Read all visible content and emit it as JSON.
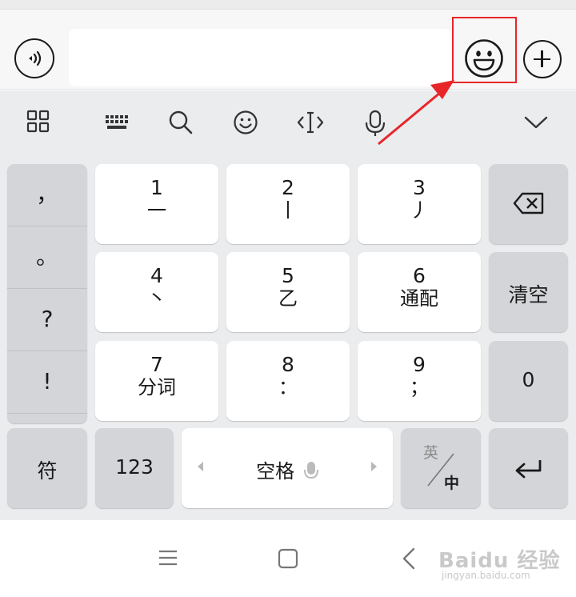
{
  "chat_bar": {
    "voice_icon": "voice-input-icon",
    "input_value": "",
    "emoji_icon": "smiley-emoji-icon",
    "plus_icon": "plus-circle-icon"
  },
  "annotation": {
    "color": "#e8262a"
  },
  "toolbar": {
    "items": [
      "grid-menu-icon",
      "keyboard-icon",
      "search-icon",
      "emoji-icon",
      "cursor-icon",
      "microphone-icon",
      "chevron-down-icon"
    ]
  },
  "keyboard": {
    "punctuation": [
      "，",
      "。",
      "?",
      "!"
    ],
    "keys": {
      "k1": {
        "num": "1",
        "sub": "一"
      },
      "k2": {
        "num": "2",
        "sub": "丨"
      },
      "k3": {
        "num": "3",
        "sub": "丿"
      },
      "k4": {
        "num": "4",
        "sub": "丶"
      },
      "k5": {
        "num": "5",
        "sub": "乙"
      },
      "k6": {
        "num": "6",
        "sub": "通配"
      },
      "k7": {
        "num": "7",
        "sub": "分词"
      },
      "k8": {
        "num": "8",
        "sub": "："
      },
      "k9": {
        "num": "9",
        "sub": "；"
      }
    },
    "clear_label": "清空",
    "zero_label": "0",
    "symbols_label": "符",
    "numbers_label": "123",
    "space_label": "空格",
    "lang_en": "英",
    "lang_zh": "中"
  },
  "watermark": {
    "line1": "Baidu 经验",
    "line2": "jingyan.baidu.com"
  }
}
